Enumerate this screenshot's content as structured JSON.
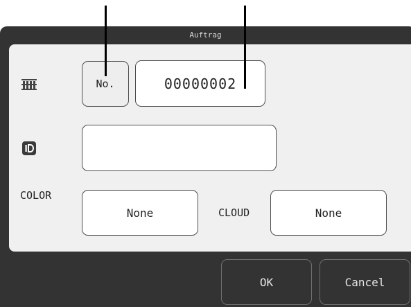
{
  "dialog": {
    "title": "Auftrag"
  },
  "order": {
    "no_button_label": "No.",
    "number_value": "00000002",
    "rack_icon": "rack-icon",
    "id_icon": "id-badge-icon",
    "id_value": ""
  },
  "options": {
    "color_label": "COLOR",
    "color_value": "None",
    "cloud_label": "CLOUD",
    "cloud_value": "None"
  },
  "footer": {
    "ok_label": "OK",
    "cancel_label": "Cancel"
  },
  "colors": {
    "dialog_bg": "#333333",
    "panel_bg": "#f0f0f0",
    "field_bg": "#ffffff",
    "border": "#4d4d4d"
  }
}
